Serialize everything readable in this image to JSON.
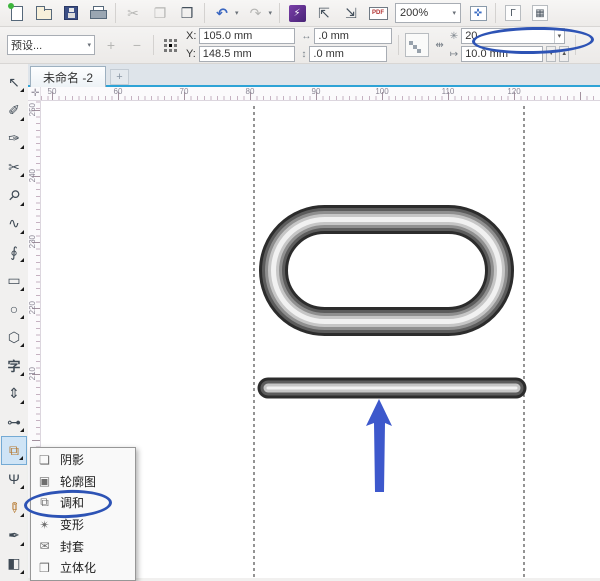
{
  "toolbar": {
    "zoom_level": "200%",
    "pdf_label": "PDF",
    "cut_glyph": "✂",
    "copy_glyph": "❐",
    "paste_glyph": "❒",
    "undo_glyph": "↶",
    "redo_glyph": "↷",
    "dropdown_glyph": "▾",
    "app_glyph": "⚡",
    "import_glyph": "⇱",
    "export_glyph": "⇲",
    "fullscreen_glyph": "✜",
    "ruler_toggle_glyph": "Γ",
    "grid_glyph": "▦"
  },
  "property_bar": {
    "preset_label": "预设...",
    "dropdown_glyph": "▾",
    "plus": "+",
    "minus": "−",
    "x_label": "X:",
    "x_value": "105.0 mm",
    "y_label": "Y:",
    "y_value": "148.5 mm",
    "width_icon": "↔",
    "width_value": ".0 mm",
    "height_icon": "↕",
    "height_value": ".0 mm",
    "direction_icon": "⇹",
    "steps_icon": "✳",
    "steps_value": "20",
    "spacing_icon": "↦",
    "spacing_value": "10.0 mm",
    "spin_down": "▼",
    "spin_up": "▲"
  },
  "tab_bar": {
    "active_tab": "未命名 -2",
    "new_tab": "+",
    "accent_color": "#2ea3d6"
  },
  "rulers": {
    "origin_glyph": "✛",
    "horizontal": [
      "50",
      "60",
      "70",
      "80",
      "90",
      "100",
      "110",
      "120"
    ],
    "vertical": [
      "250",
      "240",
      "230",
      "220",
      "210"
    ]
  },
  "toolbox": {
    "tools": [
      {
        "name": "pick-tool",
        "glyph": "↖"
      },
      {
        "name": "shape-tool",
        "glyph": "✐"
      },
      {
        "name": "freehand-smooth-tool",
        "glyph": "✑"
      },
      {
        "name": "crop-tool",
        "glyph": "✂"
      },
      {
        "name": "zoom-tool",
        "glyph": "⚲"
      },
      {
        "name": "freehand-tool",
        "glyph": "∿"
      },
      {
        "name": "artistic-media-tool",
        "glyph": "∮"
      },
      {
        "name": "rectangle-tool",
        "glyph": "▭"
      },
      {
        "name": "ellipse-tool",
        "glyph": "○"
      },
      {
        "name": "polygon-tool",
        "glyph": "⬡"
      },
      {
        "name": "text-tool",
        "glyph": "字"
      },
      {
        "name": "dimension-tool",
        "glyph": "⇕"
      },
      {
        "name": "connector-tool",
        "glyph": "⊶"
      },
      {
        "name": "blend-tool",
        "glyph": "⧉"
      },
      {
        "name": "transparency-tool",
        "glyph": "Ψ"
      },
      {
        "name": "eyedropper-tool",
        "glyph": "✏"
      },
      {
        "name": "outline-pen-tool",
        "glyph": "✒"
      },
      {
        "name": "fill-tool",
        "glyph": "◧"
      }
    ]
  },
  "flyout_menu": {
    "items": [
      {
        "label": "阴影",
        "glyph": "❏"
      },
      {
        "label": "轮廓图",
        "glyph": "▣"
      },
      {
        "label": "调和",
        "glyph": "⧉"
      },
      {
        "label": "变形",
        "glyph": "✴"
      },
      {
        "label": "封套",
        "glyph": "✉"
      },
      {
        "label": "立体化",
        "glyph": "❒"
      }
    ]
  },
  "canvas": {
    "guide_color": "#2a2a2a",
    "shape_grays": [
      "#2c2c2c",
      "#5c5c5c",
      "#8f8f8f",
      "#c6c6c6",
      "#f1f1f1"
    ],
    "arrow_color": "#3d58cc"
  },
  "annotation": {
    "color": "#2d53b5"
  }
}
